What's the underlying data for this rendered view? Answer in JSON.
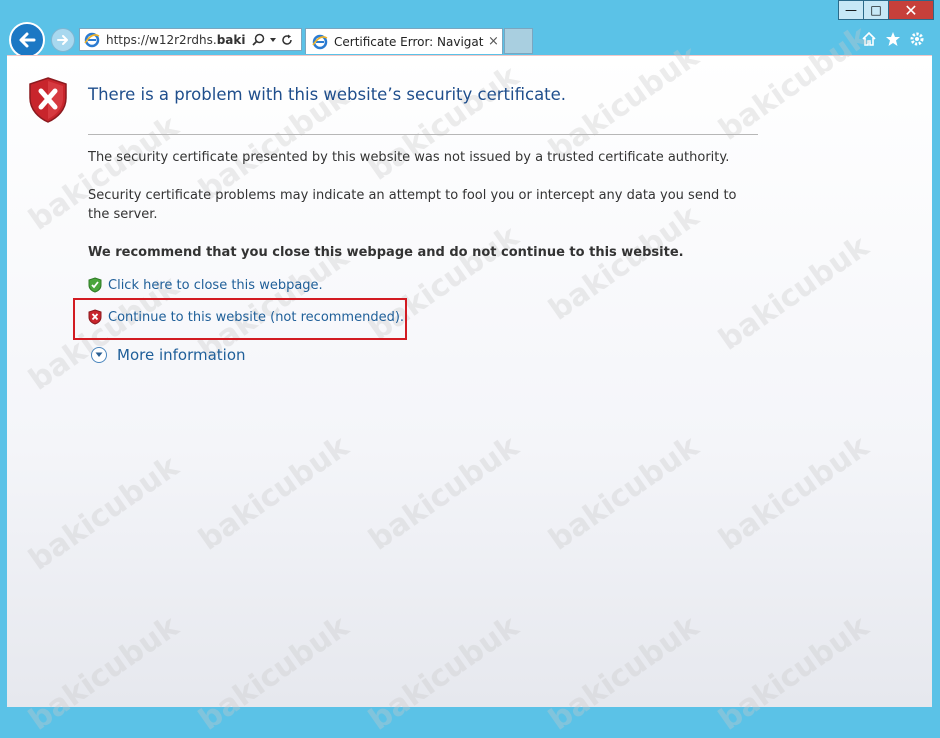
{
  "browser": {
    "address_url_prefix": "https://w12r2rdhs.",
    "address_url_bold": "bakicu...",
    "tab_title": "Certificate Error: Navigation...",
    "tab_close": "×"
  },
  "window": {
    "minimize": "—",
    "maximize": "□",
    "close": "✕"
  },
  "page": {
    "heading": "There is a problem with this website’s security certificate.",
    "paragraph1": "The security certificate presented by this website was not issued by a trusted certificate authority.",
    "paragraph2": "Security certificate problems may indicate an attempt to fool you or intercept any data you send to the server.",
    "recommendation": "We recommend that you close this webpage and do not continue to this website.",
    "close_link": "Click here to close this webpage.",
    "continue_link": "Continue to this website (not recommended).",
    "more_info": "More information"
  },
  "watermark": "bakicubuk",
  "colors": {
    "chrome": "#5bc2e7",
    "heading": "#1f4e8c",
    "link": "#1f5f99",
    "highlight_border": "#d21b22",
    "shield_red": "#c8252c",
    "shield_green": "#4aa53b"
  }
}
